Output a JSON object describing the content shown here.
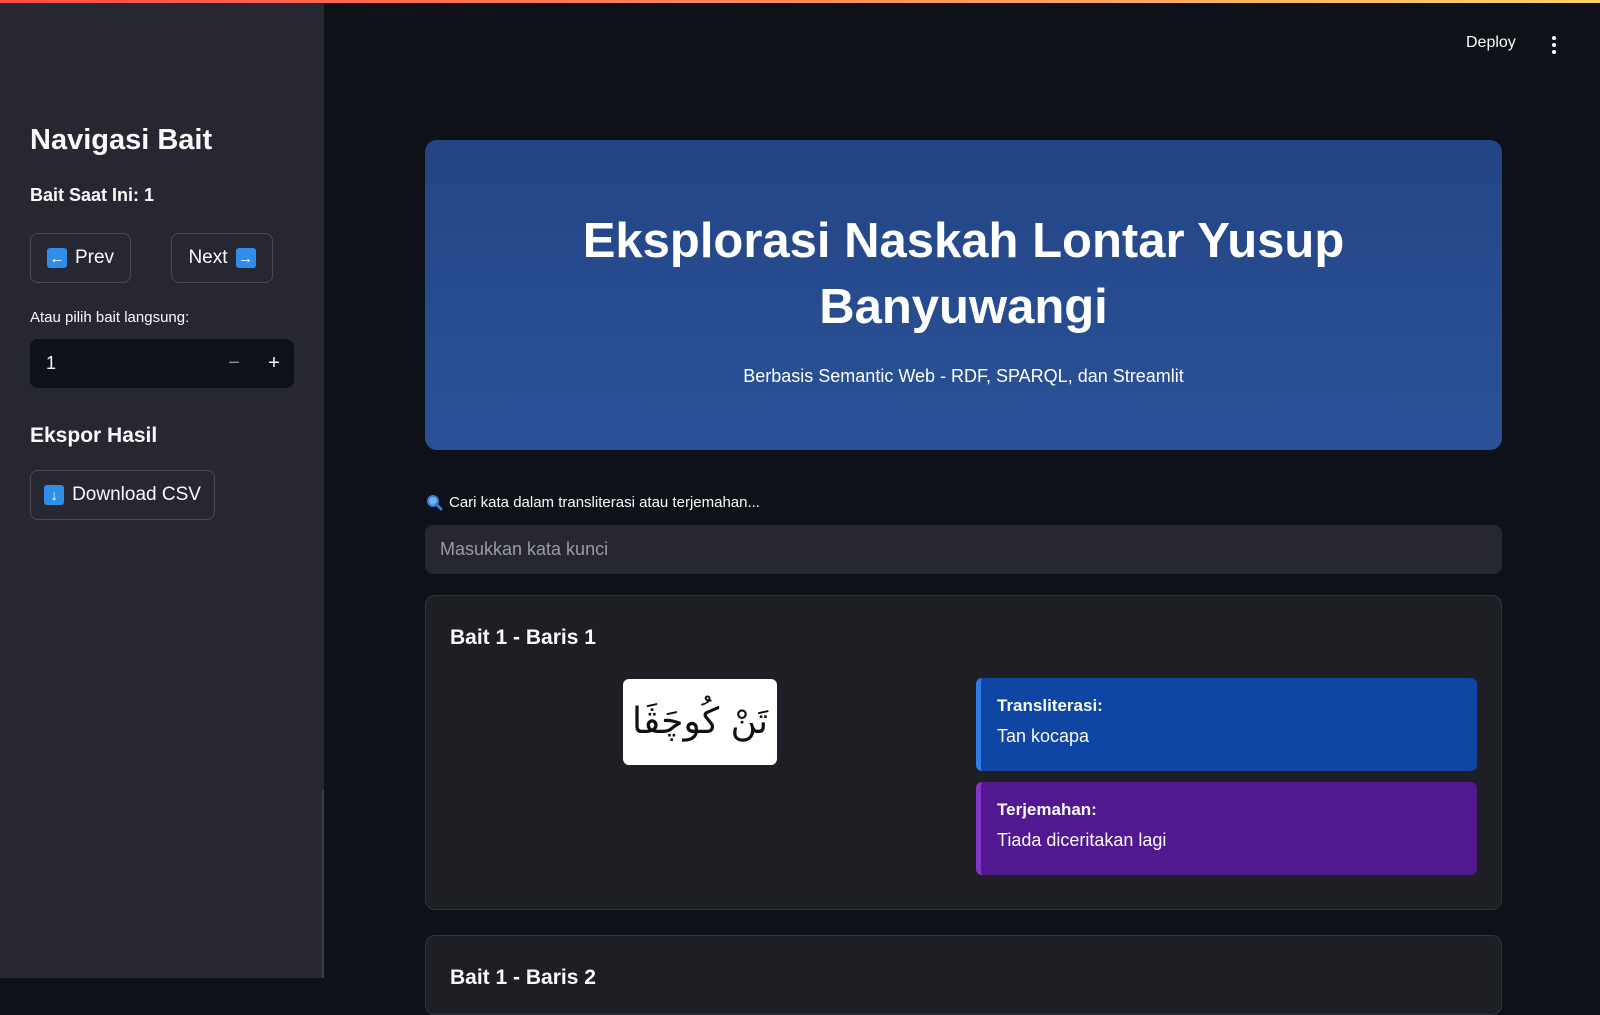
{
  "header": {
    "deploy_label": "Deploy",
    "menu_icon": "kebab-menu-icon"
  },
  "sidebar": {
    "title": "Navigasi Bait",
    "current_label": "Bait Saat Ini: 1",
    "prev_label": "Prev",
    "prev_icon": "left-arrow-icon",
    "next_label": "Next",
    "next_icon": "right-arrow-icon",
    "pick_label": "Atau pilih bait langsung:",
    "pick_value": "1",
    "export_title": "Ekspor Hasil",
    "download_label": "Download CSV",
    "download_icon": "down-arrow-icon"
  },
  "hero": {
    "title": "Eksplorasi Naskah Lontar Yusup Banyuwangi",
    "subtitle": "Berbasis Semantic Web - RDF, SPARQL, dan Streamlit",
    "background_color": "#2a4f95"
  },
  "search": {
    "label": "Cari kata dalam transliterasi atau terjemahan...",
    "icon": "magnifier-icon",
    "placeholder": "Masukkan kata kunci",
    "value": ""
  },
  "cards": [
    {
      "title": "Bait 1 - Baris 1",
      "script_text": "تَنْ كُوچَڤَا",
      "transliteration_label": "Transliterasi:",
      "transliteration": "Tan kocapa",
      "translation_label": "Terjemahan:",
      "translation": "Tiada diceritakan lagi"
    },
    {
      "title": "Bait 1 - Baris 2"
    }
  ],
  "colors": {
    "app_background": "#0e1117",
    "sidebar_background": "#262730",
    "transliteration_box": "#0f45a3",
    "translation_box": "#52188f"
  }
}
